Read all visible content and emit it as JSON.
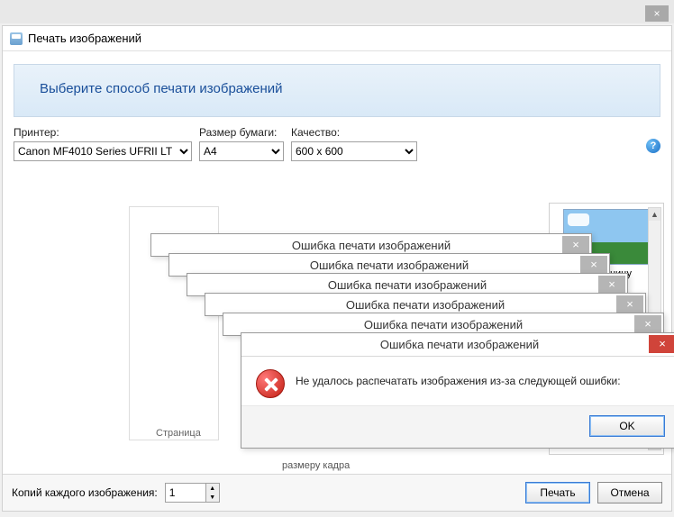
{
  "outer": {
    "close": "×"
  },
  "dialog": {
    "title": "Печать изображений",
    "banner": "Выберите способ печати изображений"
  },
  "settings": {
    "printer_label": "Принтер:",
    "printer_value": "Canon MF4010 Series UFRII LT",
    "paper_label": "Размер бумаги:",
    "paper_value": "A4",
    "quality_label": "Качество:",
    "quality_value": "600 x 600",
    "help": "?"
  },
  "layouts": {
    "full_page_label": "о страницу"
  },
  "page_label": "Страница",
  "fit_label": "размеру кадра",
  "copies": {
    "label": "Копий каждого изображения:",
    "value": "1"
  },
  "buttons": {
    "print": "Печать",
    "cancel": "Отмена",
    "ok": "OK"
  },
  "error": {
    "title": "Ошибка печати изображений",
    "message": "Не удалось распечатать изображения из-за следующей ошибки:",
    "close": "×"
  }
}
